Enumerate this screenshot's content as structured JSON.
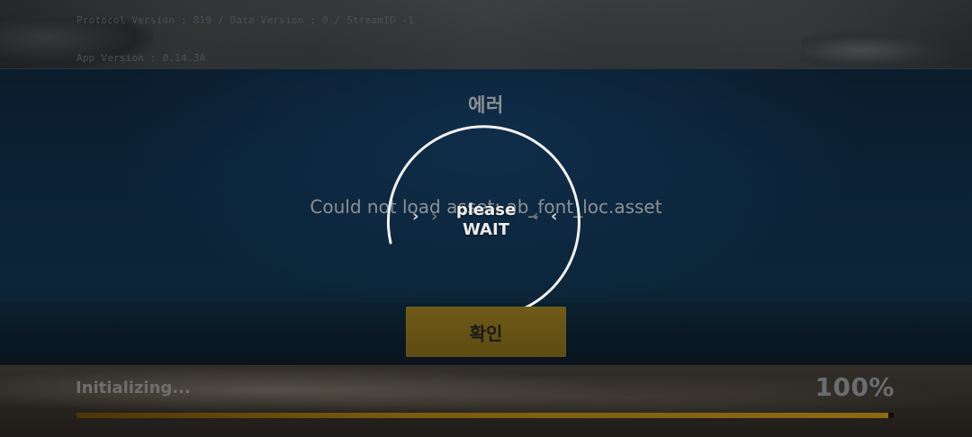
{
  "top_info": {
    "protocol_text": "Protocol Version : 819 / Data Version : 0 / StreamID -1",
    "app_version_text": "App Version : 0.14.3A"
  },
  "modal": {
    "title": "에러",
    "message": "Could not load asset: ab_font_loc.asset",
    "confirm_label": "확인",
    "confirm_color": "#6a5515"
  },
  "loading_overlay": {
    "line1": "please",
    "line2": "WAIT",
    "chevron_left": "›",
    "chevron_right": "‹",
    "spinner_color": "#f2f2f2"
  },
  "bottom_status": {
    "status_text": "Initializing...",
    "progress_label": "100%",
    "progress_fraction": 1.0,
    "progress_color": "#8c6a13"
  }
}
